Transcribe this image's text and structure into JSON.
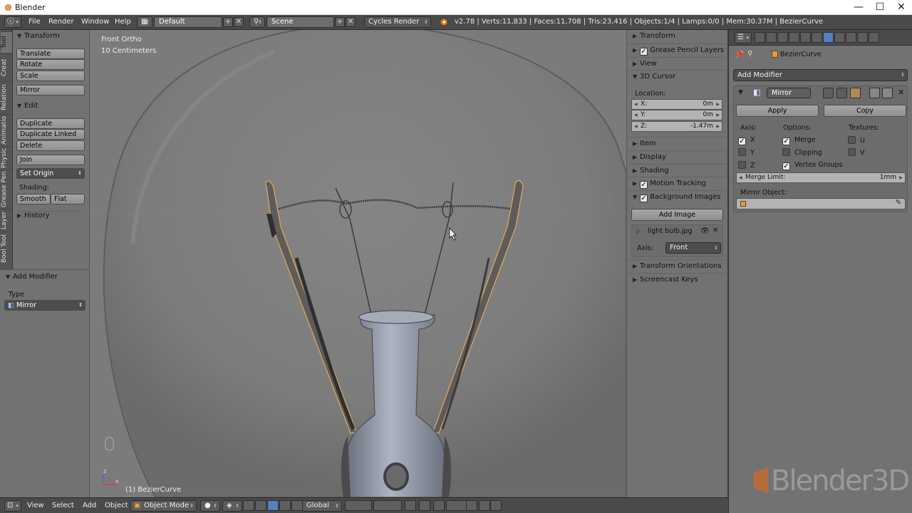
{
  "window": {
    "title": "Blender",
    "minimize": "—",
    "maximize": "☐",
    "close": "✕"
  },
  "header": {
    "menus": [
      "File",
      "Render",
      "Window",
      "Help"
    ],
    "screen_layout": "Default",
    "scene": "Scene",
    "render_engine": "Cycles Render",
    "stats": "v2.78 | Verts:11,833 | Faces:11,708 | Tris:23,416 | Objects:1/4 | Lamps:0/0 | Mem:30.37M | BezierCurve"
  },
  "tool_tabs": [
    "Tool",
    "Creat",
    "Relation",
    "Animatio",
    "Physic",
    "Grease Pen",
    "Layer",
    "Bool Tool"
  ],
  "toolshelf": {
    "transform_header": "Transform",
    "translate": "Translate",
    "rotate": "Rotate",
    "scale": "Scale",
    "mirror": "Mirror",
    "edit_header": "Edit",
    "duplicate": "Duplicate",
    "duplicate_linked": "Duplicate Linked",
    "delete": "Delete",
    "join": "Join",
    "set_origin": "Set Origin",
    "shading_label": "Shading:",
    "smooth": "Smooth",
    "flat": "Flat",
    "history_header": "History"
  },
  "redo_panel": {
    "header": "Add Modifier",
    "type_label": "Type",
    "type_value": "Mirror"
  },
  "viewport": {
    "view_name": "Front Ortho",
    "scale_text": "10 Centimeters",
    "object_label": "(1) BezierCurve"
  },
  "footer": {
    "menus": [
      "View",
      "Select",
      "Add",
      "Object"
    ],
    "mode": "Object Mode",
    "orientation": "Global"
  },
  "npanel": {
    "transform": "Transform",
    "grease_pencil_layers": "Grease Pencil Layers",
    "view": "View",
    "cursor_3d": "3D Cursor",
    "location_label": "Location:",
    "x_label": "X:",
    "x_value": "0m",
    "y_label": "Y:",
    "y_value": "0m",
    "z_label": "Z:",
    "z_value": "-1.47m",
    "item": "Item",
    "display": "Display",
    "shading": "Shading",
    "motion_tracking": "Motion Tracking",
    "background_images": "Background Images",
    "add_image": "Add Image",
    "bg_image_name": "light bulb.jpg",
    "axis_label": "Axis:",
    "axis_value": "Front",
    "transform_orientations": "Transform Orientations",
    "screencast_keys": "Screencast Keys"
  },
  "properties": {
    "object_name": "BezierCurve",
    "add_modifier": "Add Modifier",
    "modifier_name": "Mirror",
    "apply": "Apply",
    "copy": "Copy",
    "axis_label": "Axis:",
    "options_label": "Options:",
    "textures_label": "Textures:",
    "axis_x": "X",
    "axis_y": "Y",
    "axis_z": "Z",
    "merge": "Merge",
    "clipping": "Clipping",
    "vertex_groups": "Vertex Groups",
    "tex_u": "U",
    "tex_v": "V",
    "merge_limit_label": "Merge Limit:",
    "merge_limit_value": "1mm",
    "mirror_object_label": "Mirror Object:"
  },
  "watermark": "Blender3D",
  "colors": {
    "accent_blue": "#5680c2",
    "selection_orange": "#e6a15a",
    "header_gray": "#4a4a4a",
    "panel_gray": "#727272"
  }
}
